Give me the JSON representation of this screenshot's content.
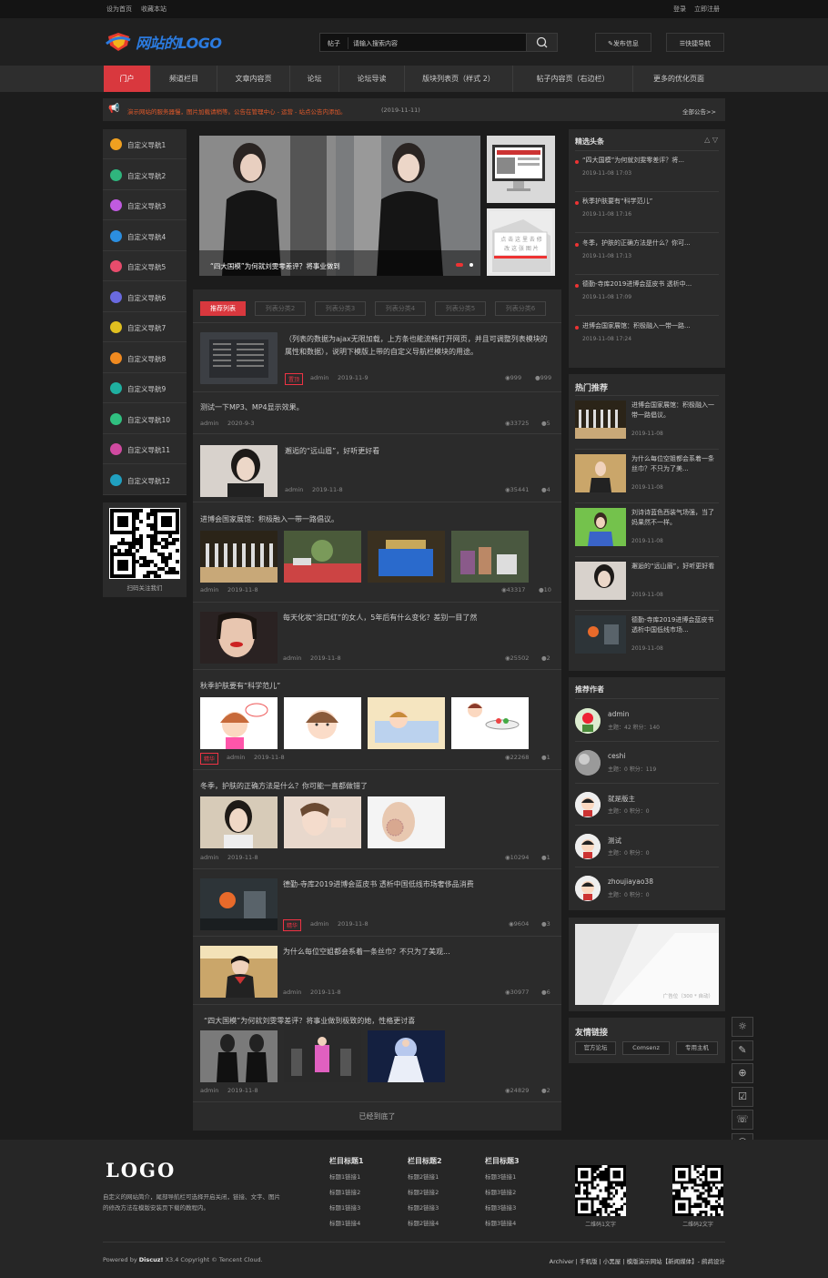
{
  "topbar": {
    "set_home": "设为首页",
    "favorite": "收藏本站",
    "login": "登录",
    "register": "立即注册"
  },
  "header": {
    "logo_text": "网站的LOGO",
    "search_label": "帖子",
    "search_placeholder": "请输入搜索内容",
    "post_btn": "发布信息",
    "quick_nav": "快捷导航"
  },
  "nav": [
    "门户",
    "频道栏目",
    "文章内容页",
    "论坛",
    "论坛导读",
    "版块列表页（样式 2）",
    "帖子内容页（右边栏）",
    "更多的优化页面"
  ],
  "notice": {
    "text": "演示网站的服务器慢，图片加载请稍等。公告在管理中心 - 运营 - 站点公告内添加。",
    "date": "(2019-11-11)",
    "all": "全部公告>>"
  },
  "leftnav": [
    "自定义导航1",
    "自定义导航2",
    "自定义导航3",
    "自定义导航4",
    "自定义导航5",
    "自定义导航6",
    "自定义导航7",
    "自定义导航8",
    "自定义导航9",
    "自定义导航10",
    "自定义导航11",
    "自定义导航12"
  ],
  "leftnav_colors": [
    "#f0a020",
    "#2fb57d",
    "#c05be0",
    "#2b8ee0",
    "#e84c6c",
    "#6a6ae0",
    "#e0c020",
    "#f08a20",
    "#1fb0a0",
    "#30c080",
    "#d04aa0",
    "#20a0c0"
  ],
  "qr_caption": "扫码关注我们",
  "slider": {
    "caption": "“四大国模”为何就刘雯零差评？将事业做到"
  },
  "thumb2_text": "点 击 这 里 去 修 改 这 张 图 片",
  "tabs": [
    "推荐列表",
    "列表分类2",
    "列表分类3",
    "列表分类4",
    "列表分类5",
    "列表分类6"
  ],
  "posts": [
    {
      "title": "（列表的数据为ajax无限加载，上方条也能流畅打开网页，并且可调整列表模块的属性和数据），说明下模版上带的自定义导航栏模块的用途。",
      "tag": "置顶",
      "author": "admin",
      "date": "2019-11-9",
      "views": "999",
      "comments": "999"
    },
    {
      "title": "测试一下MP3、MP4显示效果。",
      "author": "admin",
      "date": "2020-9-3",
      "views": "33725",
      "comments": "5"
    },
    {
      "title": "邂逅的“远山眉”，好听更好看",
      "author": "admin",
      "date": "2019-11-8",
      "views": "35441",
      "comments": "4"
    },
    {
      "title": "进博会国家展馆：积极融入一带一路倡议。",
      "author": "admin",
      "date": "2019-11-8",
      "views": "43317",
      "comments": "10"
    },
    {
      "title": "每天化妆“涂口红”的女人，5年后有什么变化？差别一目了然",
      "author": "admin",
      "date": "2019-11-8",
      "views": "25502",
      "comments": "2"
    },
    {
      "title": "秋季护肤要有“科学范儿”",
      "tag": "精华",
      "author": "admin",
      "date": "2019-11-8",
      "views": "22268",
      "comments": "1"
    },
    {
      "title": "冬季，护肤的正确方法是什么？你可能一直都做错了",
      "author": "admin",
      "date": "2019-11-8",
      "views": "10294",
      "comments": "1"
    },
    {
      "title": "德勤-寺库2019进博会蓝皮书 透析中国低线市场奢侈品消费",
      "tag": "精华",
      "author": "admin",
      "date": "2019-11-8",
      "views": "9604",
      "comments": "3"
    },
    {
      "title": "为什么每位空姐都会系着一条丝巾？不只为了美观...",
      "author": "admin",
      "date": "2019-11-8",
      "views": "30977",
      "comments": "6"
    },
    {
      "title": "“四大国模”为何就刘雯零差评？将事业做到极致的她，性格更讨喜",
      "author": "admin",
      "date": "2019-11-8",
      "views": "24829",
      "comments": "2"
    }
  ],
  "list_end": "已经到底了",
  "headlines": {
    "title": "精选头条",
    "items": [
      {
        "title": "“四大国模”为何就刘雯零差评？将...",
        "date": "2019-11-08 17:03"
      },
      {
        "title": "秋季护肤要有“科学范儿”",
        "date": "2019-11-08 17:16"
      },
      {
        "title": "冬季，护肤的正确方法是什么？你可...",
        "date": "2019-11-08 17:13"
      },
      {
        "title": "德勤-寺库2019进博会蓝皮书 透析中...",
        "date": "2019-11-08 17:09"
      },
      {
        "title": "进博会国家展馆：积极融入一带一路...",
        "date": "2019-11-08 17:24"
      }
    ]
  },
  "hot": {
    "title": "热门推荐",
    "items": [
      {
        "title": "进博会国家展馆：积极融入一带一路倡议。",
        "date": "2019-11-08"
      },
      {
        "title": "为什么每位空姐都会系着一条丝巾？不只为了美...",
        "date": "2019-11-08"
      },
      {
        "title": "刘诗诗蓝色西装气场强，当了妈果然不一样。",
        "date": "2019-11-08"
      },
      {
        "title": "邂逅的“远山眉”，好听更好看",
        "date": "2019-11-08"
      },
      {
        "title": "德勤-寺库2019进博会蓝皮书 透析中国低线市场...",
        "date": "2019-11-08"
      }
    ]
  },
  "authors": {
    "title": "推荐作者",
    "items": [
      {
        "name": "admin",
        "stats": "主题：42   积分：140"
      },
      {
        "name": "ceshi",
        "stats": "主题：0   积分：119"
      },
      {
        "name": "就是版主",
        "stats": "主题：0   积分：0"
      },
      {
        "name": "测试",
        "stats": "主题：0   积分：0"
      },
      {
        "name": "zhoujiayao38",
        "stats": "主题：0   积分：0"
      }
    ]
  },
  "ad_label": "广告位（300 * 自动）",
  "links": {
    "title": "友情链接",
    "items": [
      "官方论坛",
      "Comsenz",
      "专用主机"
    ]
  },
  "tools": [
    "☼",
    "✎",
    "⊕",
    "☑",
    "☏",
    "☺",
    "✆",
    "◎",
    "⌃"
  ],
  "footer": {
    "logo": "LOGO",
    "desc": "自定义的网站简介，尾部导航栏可选择开启关闭，链接、文字、图片的修改方法在模版安装页下载的教程内。",
    "cols": [
      {
        "title": "栏目标题1",
        "links": [
          "标题1链接1",
          "标题1链接2",
          "标题1链接3",
          "标题1链接4"
        ]
      },
      {
        "title": "栏目标题2",
        "links": [
          "标题2链接1",
          "标题2链接2",
          "标题2链接3",
          "标题2链接4"
        ]
      },
      {
        "title": "栏目标题3",
        "links": [
          "标题3链接1",
          "标题3链接2",
          "标题3链接3",
          "标题3链接4"
        ]
      }
    ],
    "qr1": "二维码1文字",
    "qr2": "二维码2文字",
    "powered": "Powered by",
    "discuz": "Discuz!",
    "version": "X3.4 Copyright © Tencent Cloud.",
    "right_links": "Archiver | 手机版 | 小黑屋 | 模版演示网站【新闻媒体】- 鹧鸪设计"
  }
}
